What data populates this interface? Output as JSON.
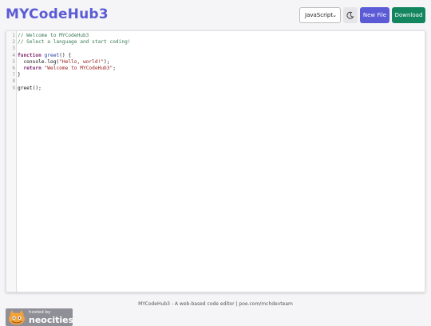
{
  "header": {
    "title": "MYCodeHub3",
    "language_select": {
      "value": "JavaScript"
    },
    "theme_toggle_icon": "moon-icon",
    "new_file_label": "New File",
    "download_label": "Download",
    "colors": {
      "title": "#5b5bd6",
      "new_file": "#5b5bd6",
      "download": "#14865f"
    }
  },
  "editor": {
    "line_numbers": [
      "1",
      "2",
      "3",
      "4",
      "5",
      "6",
      "7",
      "8",
      "9"
    ],
    "lines": [
      [
        {
          "t": "// Welcome to MYCodeHub3",
          "c": "cm"
        }
      ],
      [
        {
          "t": "// Select a language and start coding!",
          "c": "cm"
        }
      ],
      [],
      [
        {
          "t": "function",
          "c": "kw"
        },
        {
          "t": " ",
          "c": ""
        },
        {
          "t": "greet",
          "c": "fn"
        },
        {
          "t": "() {",
          "c": ""
        }
      ],
      [
        {
          "t": "  console.log(",
          "c": ""
        },
        {
          "t": "\"Hello, world!\"",
          "c": "st"
        },
        {
          "t": ");",
          "c": ""
        }
      ],
      [
        {
          "t": "  ",
          "c": ""
        },
        {
          "t": "return",
          "c": "kw"
        },
        {
          "t": " ",
          "c": ""
        },
        {
          "t": "\"Welcome to MYCodeHub3\"",
          "c": "st"
        },
        {
          "t": ";",
          "c": ""
        }
      ],
      [
        {
          "t": "}",
          "c": ""
        }
      ],
      [],
      [
        {
          "t": "greet();",
          "c": ""
        }
      ]
    ]
  },
  "footer": {
    "text": "MYCodeHub3 - A web-based code editor | poe.com/mchdevteam"
  },
  "badge": {
    "small_text": "hosted by",
    "big_text": "neocities"
  }
}
